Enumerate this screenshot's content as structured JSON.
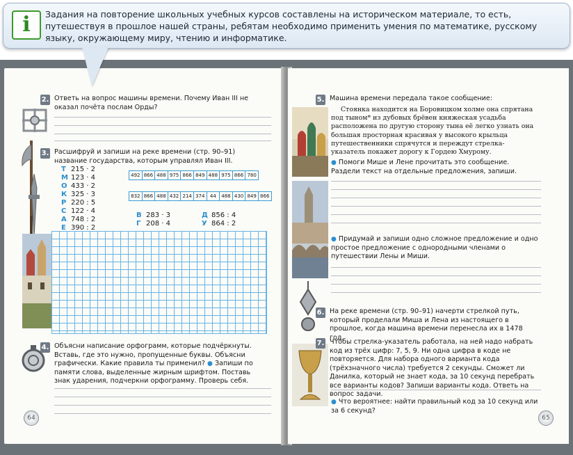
{
  "banner": {
    "text": "Задания на повторение школьных учебных курсов составлены на историческом материале, то есть, путешествуя в прошлое нашей страны, ребятам необходимо применить умения по математике, русскому языку, окружающему миру, чтению и информатике.",
    "icon": "i"
  },
  "left_page": {
    "page_number": "64",
    "task2": {
      "number": "2.",
      "text": "Ответь на вопрос машины времени. Почему Иван III не оказал почёта послам Орды?"
    },
    "task3": {
      "number": "3.",
      "text": "Расшифруй и запиши на реке времени (стр. 90–91) название государства, которым управлял Иван III.",
      "cipher_left": [
        {
          "letter": "Т",
          "expr": "215 · 2"
        },
        {
          "letter": "М",
          "expr": "123 · 4"
        },
        {
          "letter": "О",
          "expr": "433 · 2"
        },
        {
          "letter": "К",
          "expr": "325 · 3"
        },
        {
          "letter": "Р",
          "expr": "220 : 5"
        },
        {
          "letter": "С",
          "expr": "122 · 4"
        },
        {
          "letter": "А",
          "expr": "748 : 2"
        },
        {
          "letter": "Е",
          "expr": "390 : 2"
        }
      ],
      "cipher_bottom": [
        {
          "letter": "В",
          "expr": "283 · 3"
        },
        {
          "letter": "Г",
          "expr": "208 · 4"
        },
        {
          "letter": "Д",
          "expr": "856 : 4"
        },
        {
          "letter": "У",
          "expr": "864 : 2"
        }
      ],
      "code_row_1": [
        "492",
        "866",
        "488",
        "975",
        "866",
        "849",
        "488",
        "975",
        "866",
        "780"
      ],
      "code_row_2": [
        "832",
        "866",
        "488",
        "432",
        "214",
        "374",
        "44",
        "488",
        "430",
        "849",
        "866"
      ]
    },
    "task4": {
      "number": "4.",
      "text": "Объясни написание орфограмм, которые подчёркнуты. Вставь, где это нужно, пропущенные буквы. Объясни графически. Какие правила ты применил?",
      "text2": "Запиши по памяти слова, выделенные жирным шрифтом. Поставь знак ударения, подчеркни орфограмму. Проверь себя."
    }
  },
  "right_page": {
    "page_number": "65",
    "task5": {
      "number": "5.",
      "text": "Машина времени передала такое сообщение:",
      "message": "Стоянка находится на Боровицком холме она спрятана под тыном* из дубовых брёвен княжеская усадьба расположена по другую сторону тына её легко узнать она большая просторная красивая у высокого крыльца путешественники спрячутся и переждут стрелка-указатель покажет дорогу к Гордею Хмурому.",
      "bullet1": "Помоги Мише и Лене прочитать это сообщение. Раздели текст на отдельные предложения, запиши.",
      "bullet2": "Придумай и запиши одно сложное предложение и одно простое предложение с однородными членами о путешествии Лены и Миши."
    },
    "task6": {
      "number": "6.",
      "text": "На реке времени (стр. 90–91) начерти стрелкой путь, который проделали Миша и Лена из настоящего в прошлое, когда машина времени перенесла их в 1478 год."
    },
    "task7": {
      "number": "7.",
      "text": "Чтобы стрелка-указатель работала, на ней надо набрать код из трёх цифр: 7, 5, 9. Ни одна цифра в коде не повторяется. Для набора одного варианта кода (трёхзначного числа) требуется 2 секунды. Сможет ли Данилка, который не знает кода, за 10 секунд перебрать все варианты кодов? Запиши варианты кода. Ответь на вопрос задачи.",
      "bullet": "Что вероятнее: найти правильный код за 10 секунд или за 6 секунд?"
    }
  },
  "colors": {
    "banner_border": "#9fb4cc",
    "accent_blue": "#2a8fd0",
    "grid_blue": "#67b3e4",
    "number_badge": "#6f7a86",
    "book_cover": "#6b7378"
  }
}
